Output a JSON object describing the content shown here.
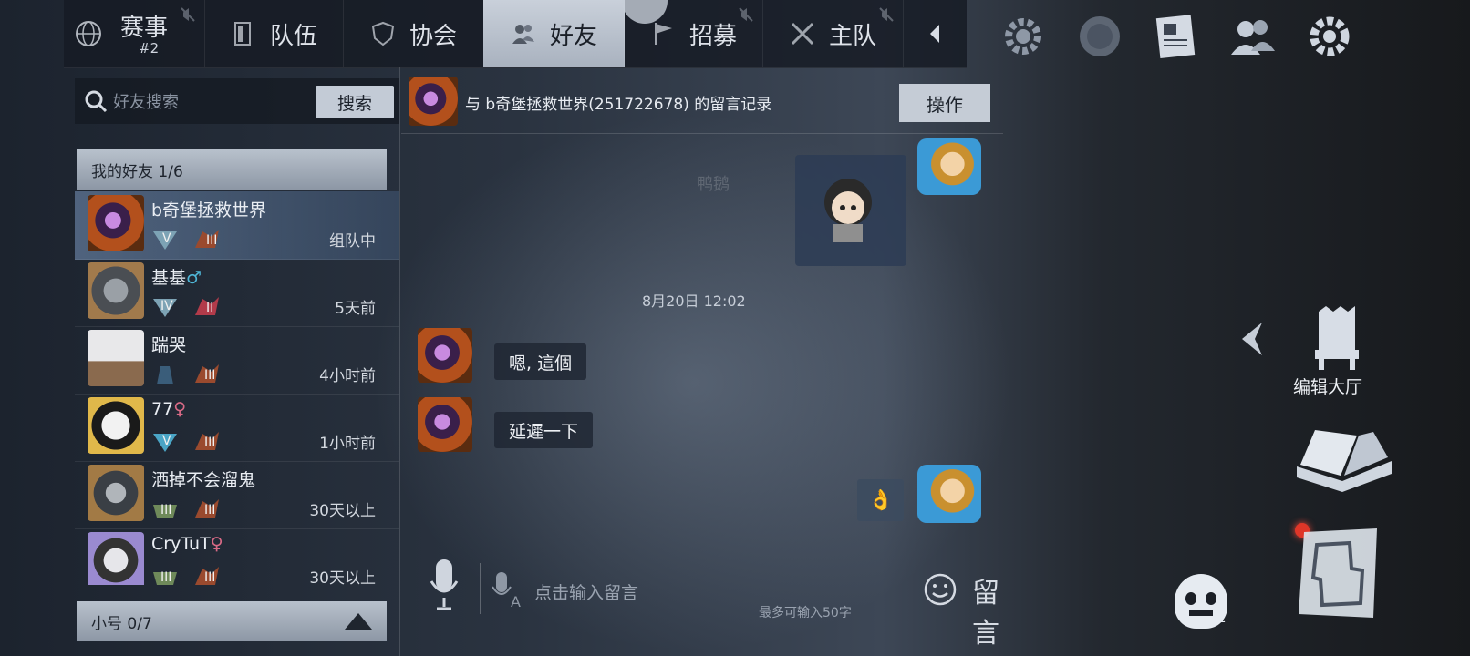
{
  "nav": {
    "tabs": [
      {
        "label": "赛事",
        "sub": "#2",
        "icon": "globe-icon"
      },
      {
        "label": "队伍",
        "icon": "door-icon"
      },
      {
        "label": "协会",
        "icon": "shield-icon"
      },
      {
        "label": "好友",
        "icon": "people-icon",
        "active": true
      },
      {
        "label": "招募",
        "icon": "flag-icon"
      },
      {
        "label": "主队",
        "icon": "crossed-swords-icon"
      }
    ],
    "right_icons": [
      "gear-icon",
      "globe-icon",
      "newspaper-icon",
      "people-icon",
      "settings-icon"
    ]
  },
  "search": {
    "placeholder": "好友搜索",
    "button": "搜索"
  },
  "friends_section": {
    "label": "我的好友 1/6"
  },
  "friends": [
    {
      "name": "b奇堡拯救世界",
      "gender": "",
      "status": "组队中",
      "selected": true,
      "rank1": "V",
      "rank2": "III"
    },
    {
      "name": "基基",
      "gender": "♂",
      "status": "5天前",
      "rank1": "IV",
      "rank2": "II"
    },
    {
      "name": "踹哭",
      "gender": "",
      "status": "4小时前",
      "rank1": "",
      "rank2": "III"
    },
    {
      "name": "77",
      "gender": "♀",
      "status": "1小时前",
      "rank1": "V",
      "rank2": "III"
    },
    {
      "name": "洒掉不会溜鬼",
      "gender": "",
      "status": "30天以上",
      "rank1": "III",
      "rank2": "III"
    },
    {
      "name": "CryTuT",
      "gender": "♀",
      "status": "30天以上",
      "rank1": "III",
      "rank2": "III"
    }
  ],
  "alt_section": {
    "label": "小号 0/7"
  },
  "chat": {
    "title": "与  b奇堡拯救世界(251722678) 的留言记录",
    "op_button": "操作",
    "faded_text": "鸭鹅",
    "timestamp": "8月20日  12:02",
    "messages": [
      {
        "from": "friend",
        "text": "嗯, 這個"
      },
      {
        "from": "friend",
        "text": "延遲一下"
      },
      {
        "from": "me",
        "text": "👌"
      }
    ],
    "input_placeholder": "点击输入留言",
    "limit": "最多可输入50字",
    "send": "留言"
  },
  "right": {
    "edit_hall": "编辑大厅",
    "skull_count": "1"
  }
}
